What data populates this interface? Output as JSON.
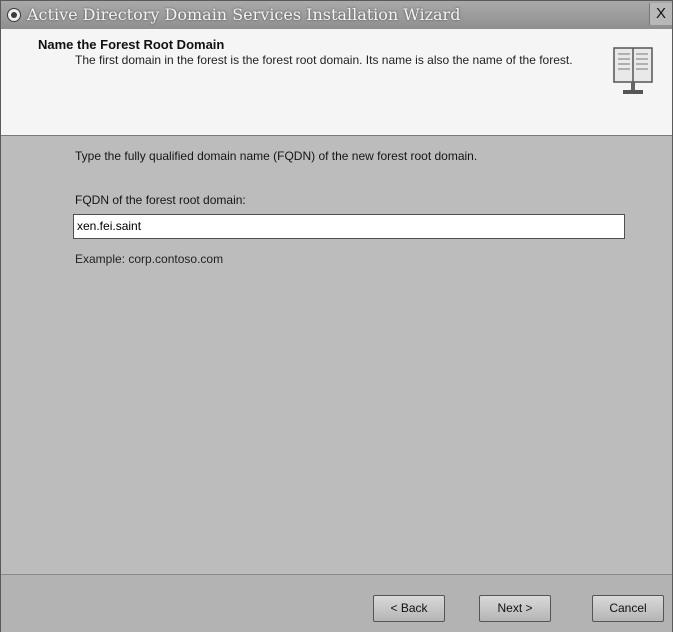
{
  "window": {
    "title": "Active Directory Domain Services Installation Wizard",
    "close_label": "X"
  },
  "header": {
    "title": "Name the Forest Root Domain",
    "description": "The first domain in the forest is the forest root domain. Its name is also the name of the forest.",
    "icon": "book-icon"
  },
  "content": {
    "instruction": "Type the fully qualified domain name (FQDN) of the new forest root domain.",
    "field_label": "FQDN of the forest root domain:",
    "field_value": "xen.fei.saint",
    "example": "Example: corp.contoso.com"
  },
  "footer": {
    "back_label": "< Back",
    "next_label": "Next >",
    "cancel_label": "Cancel"
  }
}
